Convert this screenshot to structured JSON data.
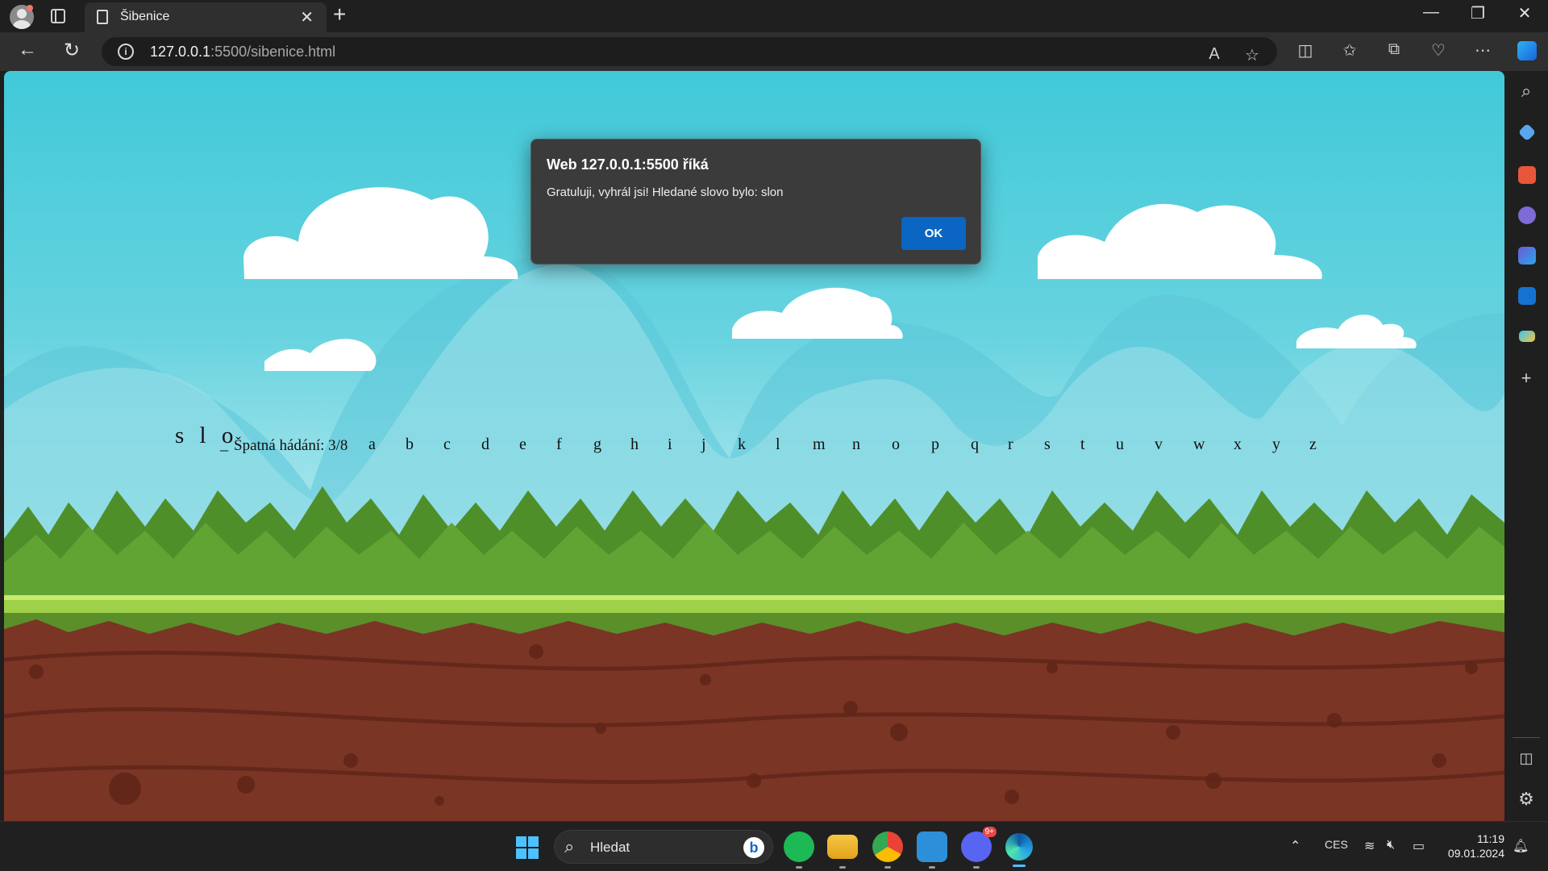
{
  "browser": {
    "tab_title": "Šibenice",
    "url_host": "127.0.0.1",
    "url_rest": ":5500/sibenice.html",
    "accent": "#0a66c2"
  },
  "dialog": {
    "title": "Web 127.0.0.1:5500 říká",
    "message": "Gratuluji, vyhrál jsi! Hledané slovo bylo: slon",
    "ok_label": "OK"
  },
  "game": {
    "revealed_word": "s l o",
    "blank": "_",
    "wrong_guesses_label": "Špatná hádání: 3/8",
    "alphabet": [
      "a",
      "b",
      "c",
      "d",
      "e",
      "f",
      "g",
      "h",
      "i",
      "j",
      "k",
      "l",
      "m",
      "n",
      "o",
      "p",
      "q",
      "r",
      "s",
      "t",
      "u",
      "v",
      "w",
      "x",
      "y",
      "z"
    ]
  },
  "taskbar": {
    "search_placeholder": "Hledat",
    "language": "CES",
    "time": "11:19",
    "date": "09.01.2024",
    "discord_badge": "9+"
  }
}
